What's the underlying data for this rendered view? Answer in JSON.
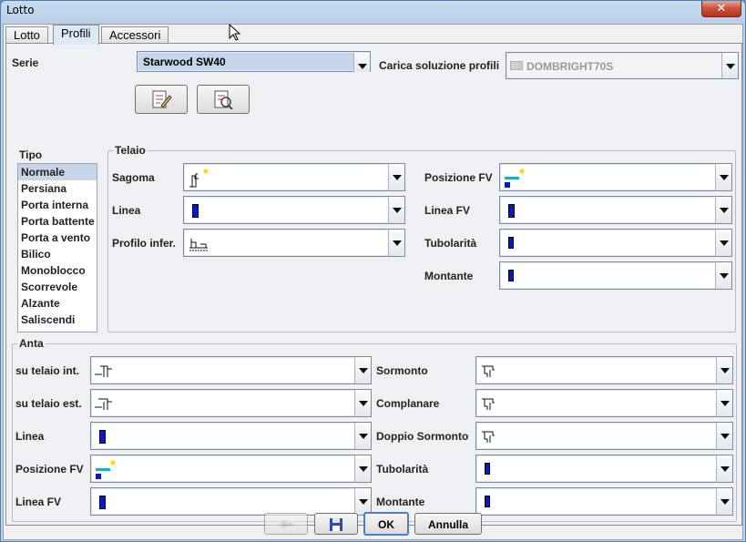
{
  "window": {
    "title": "Lotto",
    "close_glyph": "✕"
  },
  "tabs": [
    "Lotto",
    "Profili",
    "Accessori"
  ],
  "serie": {
    "label": "Serie",
    "value": "Starwood SW40"
  },
  "carica": {
    "label": "Carica soluzione profili",
    "value": "DOMBRIGHT70S"
  },
  "tipo": {
    "title": "Tipo",
    "items": [
      "Normale",
      "Persiana",
      "Porta interna",
      "Porta battente",
      "Porta a vento",
      "Bilico",
      "Monoblocco",
      "Scorrevole",
      "Alzante",
      "Saliscendi"
    ],
    "selected": "Normale"
  },
  "telaio": {
    "title": "Telaio",
    "left": [
      "Sagoma",
      "Linea",
      "Profilo infer."
    ],
    "right": [
      "Posizione FV",
      "Linea FV",
      "Tubolarità",
      "Montante"
    ]
  },
  "anta": {
    "title": "Anta",
    "left": [
      "su telaio int.",
      "su telaio est.",
      "Linea",
      "Posizione FV",
      "Linea FV"
    ],
    "right": [
      "Sormonto",
      "Complanare",
      "Doppio Sormonto",
      "Tubolarità",
      "Montante"
    ]
  },
  "buttons": {
    "ok": "OK",
    "annulla": "Annulla"
  },
  "colors": {
    "profile_blue": "#0a18c8",
    "accent_yellow": "#ffd800",
    "light_blue": "#21a6d9"
  }
}
